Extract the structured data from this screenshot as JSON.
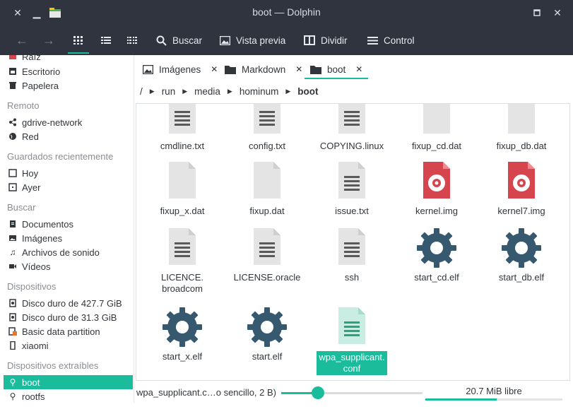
{
  "window": {
    "title": "boot — Dolphin"
  },
  "toolbar": {
    "buscar": "Buscar",
    "vista_previa": "Vista previa",
    "dividir": "Dividir",
    "control": "Control"
  },
  "sidebar": {
    "partial_top": "Raíz",
    "places": [
      "Escritorio",
      "Papelera"
    ],
    "remote_head": "Remoto",
    "remote": [
      "gdrive-network",
      "Red"
    ],
    "recent_head": "Guardados recientemente",
    "recent": [
      "Hoy",
      "Ayer"
    ],
    "search_head": "Buscar",
    "search": [
      "Documentos",
      "Imágenes",
      "Archivos de sonido",
      "Vídeos"
    ],
    "devices_head": "Dispositivos",
    "devices": [
      "Disco duro de 427.7 GiB",
      "Disco duro de 31.3 GiB",
      "Basic data partition",
      "xiaomi"
    ],
    "removable_head": "Dispositivos extraíbles",
    "removable": [
      "boot",
      "rootfs"
    ]
  },
  "tabs": [
    {
      "label": "Imágenes"
    },
    {
      "label": "Markdown"
    },
    {
      "label": "boot"
    }
  ],
  "breadcrumb": [
    "/",
    "run",
    "media",
    "hominum",
    "boot"
  ],
  "files": [
    {
      "name": "cmdline.txt",
      "icon": "text-doc"
    },
    {
      "name": "config.txt",
      "icon": "text-doc"
    },
    {
      "name": "COPYING.linux",
      "icon": "text-doc"
    },
    {
      "name": "fixup_cd.dat",
      "icon": "blank-doc"
    },
    {
      "name": "fixup_db.dat",
      "icon": "blank-doc"
    },
    {
      "name": "fixup_x.dat",
      "icon": "blank-doc"
    },
    {
      "name": "fixup.dat",
      "icon": "blank-doc"
    },
    {
      "name": "issue.txt",
      "icon": "text-doc"
    },
    {
      "name": "kernel.img",
      "icon": "disk-image"
    },
    {
      "name": "kernel7.img",
      "icon": "disk-image"
    },
    {
      "name_l1": "LICENCE.",
      "name_l2": "broadcom",
      "icon": "text-doc"
    },
    {
      "name": "LICENSE.oracle",
      "icon": "text-doc"
    },
    {
      "name": "ssh",
      "icon": "text-doc"
    },
    {
      "name": "start_cd.elf",
      "icon": "gear"
    },
    {
      "name": "start_db.elf",
      "icon": "gear"
    },
    {
      "name": "start_x.elf",
      "icon": "gear"
    },
    {
      "name": "start.elf",
      "icon": "gear"
    },
    {
      "name_l1": "wpa_supplicant.",
      "name_l2": "conf",
      "icon": "text-doc-green",
      "selected": true
    }
  ],
  "status": {
    "text": "wpa_supplicant.c…o sencillo, 2 B)",
    "free": "20.7 MiB libre",
    "zoom_fraction": 0.26,
    "free_fraction": 0.52
  },
  "colors": {
    "accent": "#1abc9c",
    "gear": "#37596f",
    "disk": "#d6444d"
  }
}
